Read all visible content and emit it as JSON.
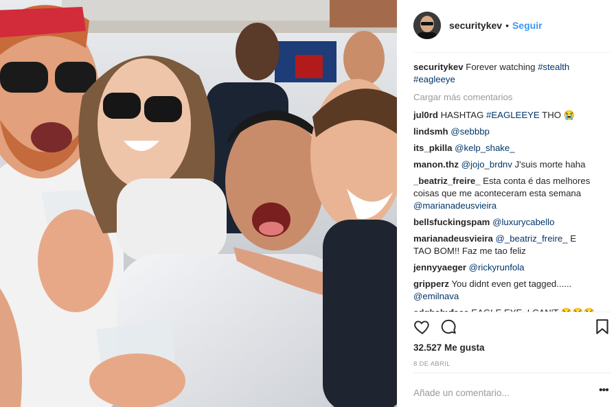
{
  "post": {
    "username": "securitykev",
    "separator": "•",
    "follow_label": "Seguir",
    "caption": {
      "user": "securitykev",
      "text": "Forever watching ",
      "tags": "#stealth #eagleeye"
    },
    "load_more_label": "Cargar más comentarios",
    "comments": [
      {
        "user": "jul0rd",
        "text": "HASHTAG ",
        "mention": "#EAGLEEYE",
        "after": " THO 😭"
      },
      {
        "user": "lindsmh",
        "text": "",
        "mention": "@sebbbp",
        "after": ""
      },
      {
        "user": "its_pkilla",
        "text": "",
        "mention": "@kelp_shake_",
        "after": ""
      },
      {
        "user": "manon.thz",
        "text": "",
        "mention": "@jojo_brdnv",
        "after": " J'suis morte haha"
      },
      {
        "user": "_beatriz_freire_",
        "text": "Esta conta é das melhores coisas que me aconteceram esta semana ",
        "mention": "@marianadeusvieira",
        "after": ""
      },
      {
        "user": "bellsfuckingspam",
        "text": "",
        "mention": "@luxurycabello",
        "after": ""
      },
      {
        "user": "marianadeusvieira",
        "text": "",
        "mention": "@_beatriz_freire_",
        "after": " E TAO BOM!! Faz me tao feliz"
      },
      {
        "user": "jennyyaeger",
        "text": "",
        "mention": "@rickyrunfola",
        "after": ""
      },
      {
        "user": "gripperz",
        "text": "You didnt even get tagged...... ",
        "mention": "@emilnava",
        "after": ""
      },
      {
        "user": "edgbabyface",
        "text": "EAGLE EYE, I CAN'T 😂😂😂😂",
        "mention": "",
        "after": ""
      }
    ],
    "likes_text": "32.527 Me gusta",
    "date_text": "8 DE ABRIL",
    "add_comment_placeholder": "Añade un comentario...",
    "options_label": "•••"
  },
  "icons": {
    "like": "heart-icon",
    "comment": "comment-bubble-icon",
    "save": "bookmark-icon",
    "options": "more-options-icon"
  },
  "colors": {
    "link": "#3897f0",
    "mention": "#003569",
    "muted": "#999999",
    "text": "#262626"
  }
}
